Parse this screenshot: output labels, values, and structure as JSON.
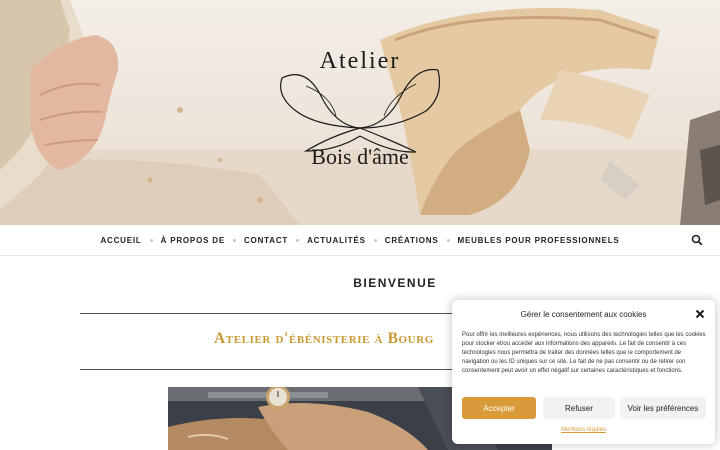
{
  "site": {
    "logo_top": "Atelier",
    "logo_bottom": "Bois d'âme"
  },
  "nav": {
    "items": [
      "ACCUEIL",
      "À PROPOS DE",
      "CONTACT",
      "ACTUALITÉS",
      "CRÉATIONS",
      "MEUBLES POUR PROFESSIONNELS"
    ],
    "search_icon": "search-icon"
  },
  "main": {
    "page_title": "BIENVENUE",
    "headline": "Atelier d'ébénisterie à Bourg"
  },
  "cookie_banner": {
    "title": "Gérer le consentement aux cookies",
    "text": "Pour offrir les meilleures expériences, nous utilisons des technologies telles que les cookies pour stocker et/ou accéder aux informations des appareils. Le fait de consentir à ces technologies nous permettra de traiter des données telles que le comportement de navigation ou les ID uniques sur ce site. Le fait de ne pas consentir ou de retirer son consentement peut avoir un effet négatif sur certaines caractéristiques et fonctions.",
    "accept_label": "Accepter",
    "refuse_label": "Refuser",
    "preferences_label": "Voir les préférences",
    "legal_link": "Mentions légales",
    "close_icon": "close-icon"
  },
  "colors": {
    "accent": "#d99a39",
    "headline": "#c99a33"
  }
}
